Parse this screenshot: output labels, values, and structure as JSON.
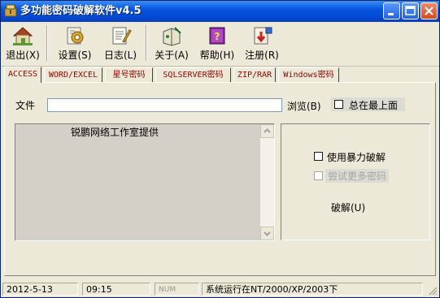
{
  "window": {
    "title": "多功能密码破解软件v4.5"
  },
  "toolbar": {
    "exit_label": "退出(X)",
    "settings_label": "设置(S)",
    "log_label": "日志(L)",
    "about_label": "关于(A)",
    "help_label": "帮助(H)",
    "register_label": "注册(R)"
  },
  "tabs": [
    {
      "label": "ACCESS"
    },
    {
      "label": "WORD/EXCEL"
    },
    {
      "label": "星号密码"
    },
    {
      "label": "SQLSERVER密码"
    },
    {
      "label": "ZIP/RAR"
    },
    {
      "label": "Windows密码"
    }
  ],
  "file": {
    "label": "文件",
    "value": "",
    "browse_label": "浏览(B)",
    "always_on_top_label": "总在最上面"
  },
  "listbox": {
    "text": "锐鹏网络工作室提供"
  },
  "options": {
    "brute_force_label": "使用暴力破解",
    "try_more_label": "尝试更多密码",
    "crack_label": "破解(U)"
  },
  "statusbar": {
    "date": "2012-5-13",
    "time": "09:15",
    "num": "NUM",
    "message": "系统运行在NT/2000/XP/2003下"
  },
  "colors": {
    "title_blue": "#0655e0",
    "tab_text": "#a00000",
    "face": "#ece9d8"
  }
}
